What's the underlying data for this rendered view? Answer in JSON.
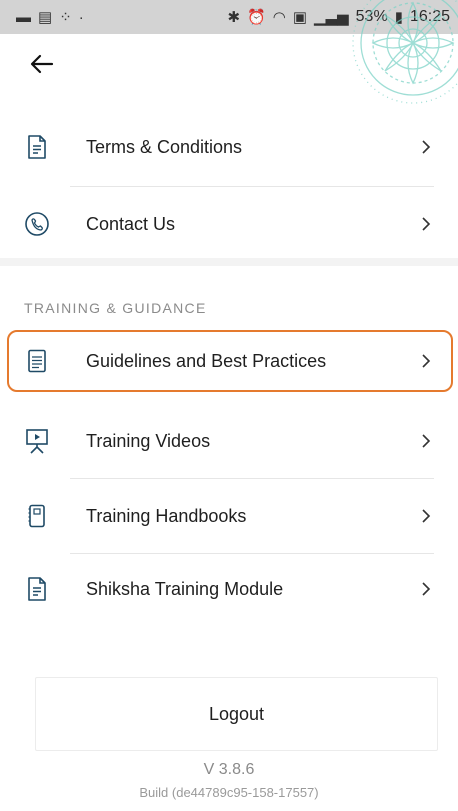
{
  "status_bar": {
    "battery": "53%",
    "time": "16:25"
  },
  "menu": {
    "items_top": [
      {
        "label": "Terms & Conditions",
        "icon": "document-icon"
      },
      {
        "label": "Contact Us",
        "icon": "phone-contact-icon"
      }
    ],
    "section_header": "TRAINING & GUIDANCE",
    "items_training": [
      {
        "label": "Guidelines and Best Practices",
        "icon": "checklist-icon",
        "highlighted": true
      },
      {
        "label": "Training Videos",
        "icon": "presentation-icon"
      },
      {
        "label": "Training Handbooks",
        "icon": "handbook-icon"
      },
      {
        "label": "Shiksha Training Module",
        "icon": "document-icon"
      }
    ]
  },
  "logout": {
    "label": "Logout"
  },
  "app_info": {
    "version": "V 3.8.6",
    "build": "Build (de44789c95-158-17557)"
  },
  "colors": {
    "highlight": "#e57a2e",
    "icon_stroke": "#1f4a66",
    "mandala": "#7fd3c8"
  }
}
